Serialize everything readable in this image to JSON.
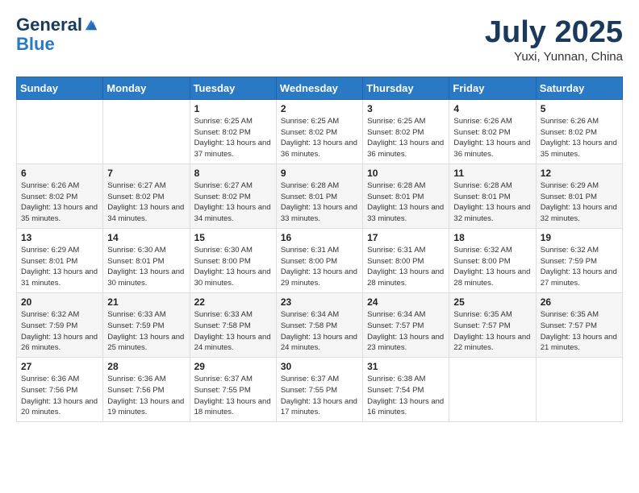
{
  "header": {
    "logo_general": "General",
    "logo_blue": "Blue",
    "month_year": "July 2025",
    "location": "Yuxi, Yunnan, China"
  },
  "weekdays": [
    "Sunday",
    "Monday",
    "Tuesday",
    "Wednesday",
    "Thursday",
    "Friday",
    "Saturday"
  ],
  "weeks": [
    [
      {
        "day": "",
        "info": ""
      },
      {
        "day": "",
        "info": ""
      },
      {
        "day": "1",
        "info": "Sunrise: 6:25 AM\nSunset: 8:02 PM\nDaylight: 13 hours and 37 minutes."
      },
      {
        "day": "2",
        "info": "Sunrise: 6:25 AM\nSunset: 8:02 PM\nDaylight: 13 hours and 36 minutes."
      },
      {
        "day": "3",
        "info": "Sunrise: 6:25 AM\nSunset: 8:02 PM\nDaylight: 13 hours and 36 minutes."
      },
      {
        "day": "4",
        "info": "Sunrise: 6:26 AM\nSunset: 8:02 PM\nDaylight: 13 hours and 36 minutes."
      },
      {
        "day": "5",
        "info": "Sunrise: 6:26 AM\nSunset: 8:02 PM\nDaylight: 13 hours and 35 minutes."
      }
    ],
    [
      {
        "day": "6",
        "info": "Sunrise: 6:26 AM\nSunset: 8:02 PM\nDaylight: 13 hours and 35 minutes."
      },
      {
        "day": "7",
        "info": "Sunrise: 6:27 AM\nSunset: 8:02 PM\nDaylight: 13 hours and 34 minutes."
      },
      {
        "day": "8",
        "info": "Sunrise: 6:27 AM\nSunset: 8:02 PM\nDaylight: 13 hours and 34 minutes."
      },
      {
        "day": "9",
        "info": "Sunrise: 6:28 AM\nSunset: 8:01 PM\nDaylight: 13 hours and 33 minutes."
      },
      {
        "day": "10",
        "info": "Sunrise: 6:28 AM\nSunset: 8:01 PM\nDaylight: 13 hours and 33 minutes."
      },
      {
        "day": "11",
        "info": "Sunrise: 6:28 AM\nSunset: 8:01 PM\nDaylight: 13 hours and 32 minutes."
      },
      {
        "day": "12",
        "info": "Sunrise: 6:29 AM\nSunset: 8:01 PM\nDaylight: 13 hours and 32 minutes."
      }
    ],
    [
      {
        "day": "13",
        "info": "Sunrise: 6:29 AM\nSunset: 8:01 PM\nDaylight: 13 hours and 31 minutes."
      },
      {
        "day": "14",
        "info": "Sunrise: 6:30 AM\nSunset: 8:01 PM\nDaylight: 13 hours and 30 minutes."
      },
      {
        "day": "15",
        "info": "Sunrise: 6:30 AM\nSunset: 8:00 PM\nDaylight: 13 hours and 30 minutes."
      },
      {
        "day": "16",
        "info": "Sunrise: 6:31 AM\nSunset: 8:00 PM\nDaylight: 13 hours and 29 minutes."
      },
      {
        "day": "17",
        "info": "Sunrise: 6:31 AM\nSunset: 8:00 PM\nDaylight: 13 hours and 28 minutes."
      },
      {
        "day": "18",
        "info": "Sunrise: 6:32 AM\nSunset: 8:00 PM\nDaylight: 13 hours and 28 minutes."
      },
      {
        "day": "19",
        "info": "Sunrise: 6:32 AM\nSunset: 7:59 PM\nDaylight: 13 hours and 27 minutes."
      }
    ],
    [
      {
        "day": "20",
        "info": "Sunrise: 6:32 AM\nSunset: 7:59 PM\nDaylight: 13 hours and 26 minutes."
      },
      {
        "day": "21",
        "info": "Sunrise: 6:33 AM\nSunset: 7:59 PM\nDaylight: 13 hours and 25 minutes."
      },
      {
        "day": "22",
        "info": "Sunrise: 6:33 AM\nSunset: 7:58 PM\nDaylight: 13 hours and 24 minutes."
      },
      {
        "day": "23",
        "info": "Sunrise: 6:34 AM\nSunset: 7:58 PM\nDaylight: 13 hours and 24 minutes."
      },
      {
        "day": "24",
        "info": "Sunrise: 6:34 AM\nSunset: 7:57 PM\nDaylight: 13 hours and 23 minutes."
      },
      {
        "day": "25",
        "info": "Sunrise: 6:35 AM\nSunset: 7:57 PM\nDaylight: 13 hours and 22 minutes."
      },
      {
        "day": "26",
        "info": "Sunrise: 6:35 AM\nSunset: 7:57 PM\nDaylight: 13 hours and 21 minutes."
      }
    ],
    [
      {
        "day": "27",
        "info": "Sunrise: 6:36 AM\nSunset: 7:56 PM\nDaylight: 13 hours and 20 minutes."
      },
      {
        "day": "28",
        "info": "Sunrise: 6:36 AM\nSunset: 7:56 PM\nDaylight: 13 hours and 19 minutes."
      },
      {
        "day": "29",
        "info": "Sunrise: 6:37 AM\nSunset: 7:55 PM\nDaylight: 13 hours and 18 minutes."
      },
      {
        "day": "30",
        "info": "Sunrise: 6:37 AM\nSunset: 7:55 PM\nDaylight: 13 hours and 17 minutes."
      },
      {
        "day": "31",
        "info": "Sunrise: 6:38 AM\nSunset: 7:54 PM\nDaylight: 13 hours and 16 minutes."
      },
      {
        "day": "",
        "info": ""
      },
      {
        "day": "",
        "info": ""
      }
    ]
  ]
}
